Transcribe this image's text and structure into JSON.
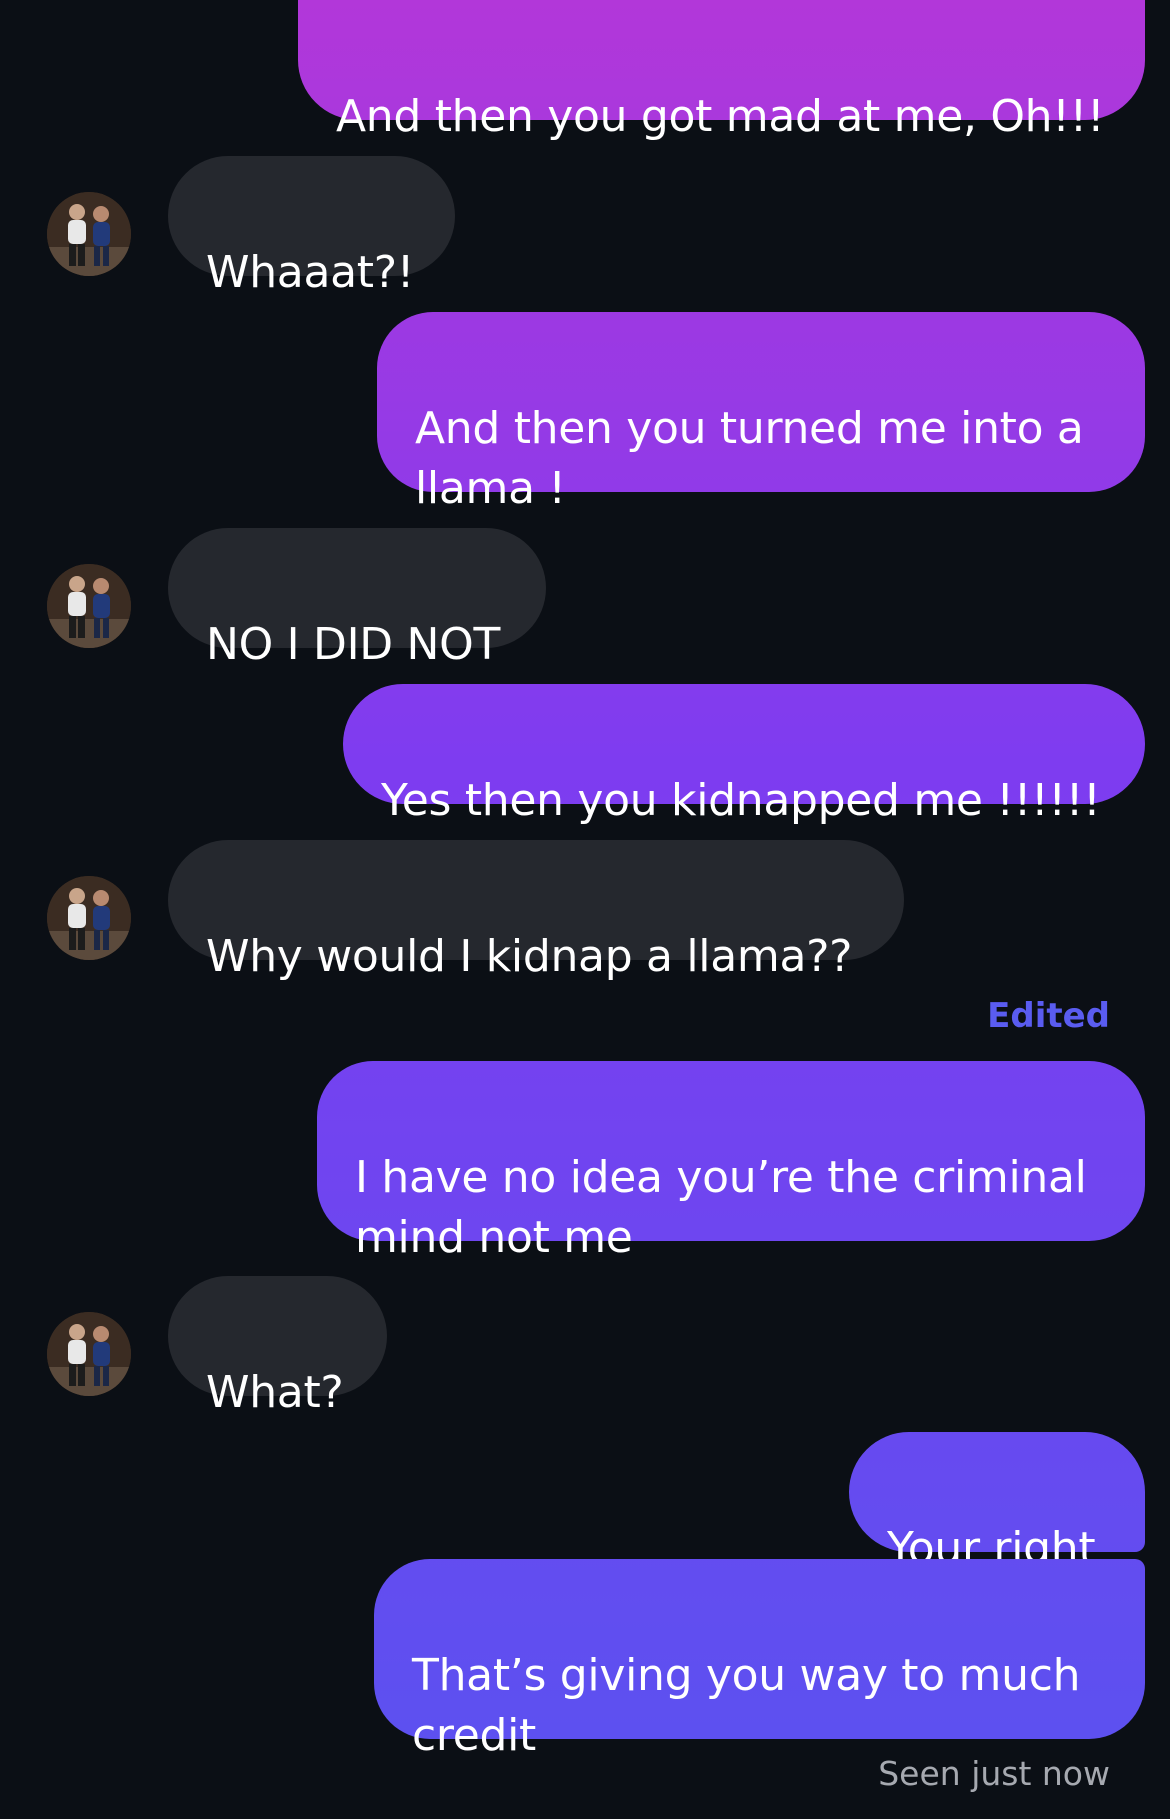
{
  "thread": {
    "messages": [
      {
        "sender": "me",
        "text": "And then you got mad at me, Oh!!!"
      },
      {
        "sender": "them",
        "text": "Whaaat?!"
      },
      {
        "sender": "me",
        "text": "And then you turned me into a\nllama !"
      },
      {
        "sender": "them",
        "text": "NO I DID NOT"
      },
      {
        "sender": "me",
        "text": "Yes then you kidnapped me !!!!!!"
      },
      {
        "sender": "them",
        "text": "Why would I kidnap a llama??"
      },
      {
        "sender": "me",
        "text": "I have no idea you’re the criminal\nmind not me"
      },
      {
        "sender": "them",
        "text": "What?"
      },
      {
        "sender": "me",
        "text": "Your right"
      },
      {
        "sender": "me",
        "text": "That’s giving you way to much\ncredit"
      }
    ],
    "edited_label": "Edited",
    "seen_label": "Seen just now"
  },
  "colors": {
    "background": "#0b0f15",
    "incoming_bubble": "#25282e",
    "outgoing_gradient_top": "#b237d9",
    "outgoing_gradient_bottom": "#5a52f0",
    "edited_text": "#5a5cf0",
    "seen_text": "#a6a9b0"
  },
  "icons": {
    "avatar": "contact-avatar-photo"
  }
}
